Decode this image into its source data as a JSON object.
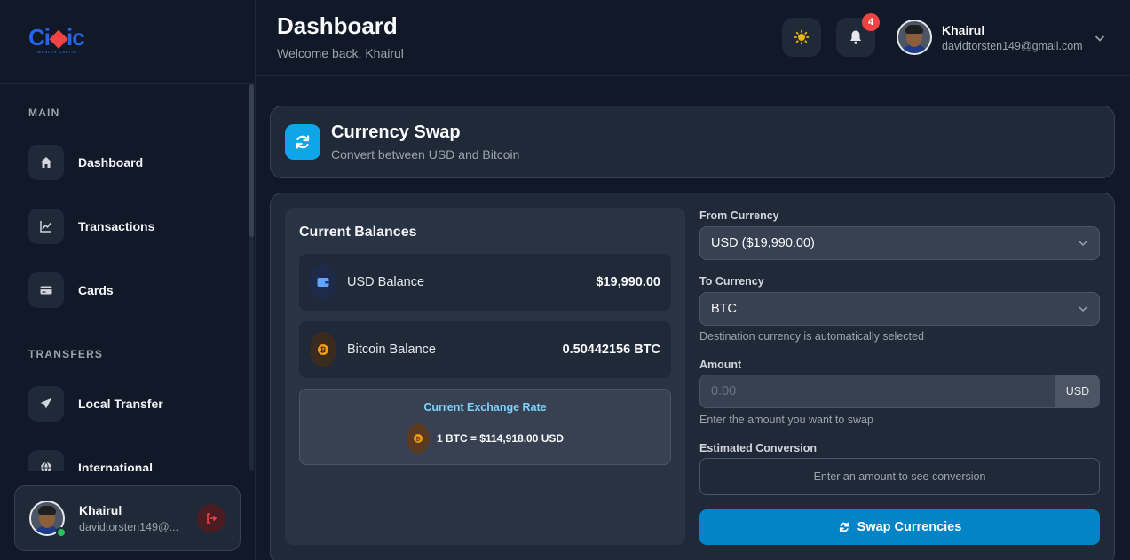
{
  "brand": {
    "logo_main": "Ci",
    "logo_mid": "v",
    "logo_end": "ic",
    "logo_sub": "WEALTH CAPITA"
  },
  "sidebar": {
    "section_main": "MAIN",
    "section_transfers": "TRANSFERS",
    "items": [
      {
        "label": "Dashboard",
        "icon": "home-icon"
      },
      {
        "label": "Transactions",
        "icon": "chart-line-icon"
      },
      {
        "label": "Cards",
        "icon": "credit-card-icon"
      },
      {
        "label": "Local Transfer",
        "icon": "paper-plane-icon"
      },
      {
        "label": "International",
        "icon": "globe-icon"
      }
    ],
    "user": {
      "name": "Khairul",
      "email": "davidtorsten149@..."
    }
  },
  "header": {
    "title": "Dashboard",
    "subtitle": "Welcome back, Khairul",
    "notification_count": "4",
    "user": {
      "name": "Khairul",
      "email": "davidtorsten149@gmail.com"
    }
  },
  "swap_panel": {
    "title": "Currency Swap",
    "subtitle": "Convert between USD and Bitcoin"
  },
  "balances": {
    "title": "Current Balances",
    "usd_label": "USD Balance",
    "usd_value": "$19,990.00",
    "btc_label": "Bitcoin Balance",
    "btc_value": "0.50442156 BTC",
    "rate_title": "Current Exchange Rate",
    "rate_text": "1 BTC = $114,918.00 USD"
  },
  "form": {
    "from_label": "From Currency",
    "from_value": "USD ($19,990.00)",
    "to_label": "To Currency",
    "to_value": "BTC",
    "to_hint": "Destination currency is automatically selected",
    "amount_label": "Amount",
    "amount_placeholder": "0.00",
    "amount_suffix": "USD",
    "amount_hint": "Enter the amount you want to swap",
    "conversion_label": "Estimated Conversion",
    "conversion_text": "Enter an amount to see conversion",
    "swap_button": "Swap Currencies"
  },
  "colors": {
    "accent": "#0284c7",
    "bitcoin": "#f59e0b",
    "danger": "#ef4444",
    "online": "#22c55e"
  }
}
